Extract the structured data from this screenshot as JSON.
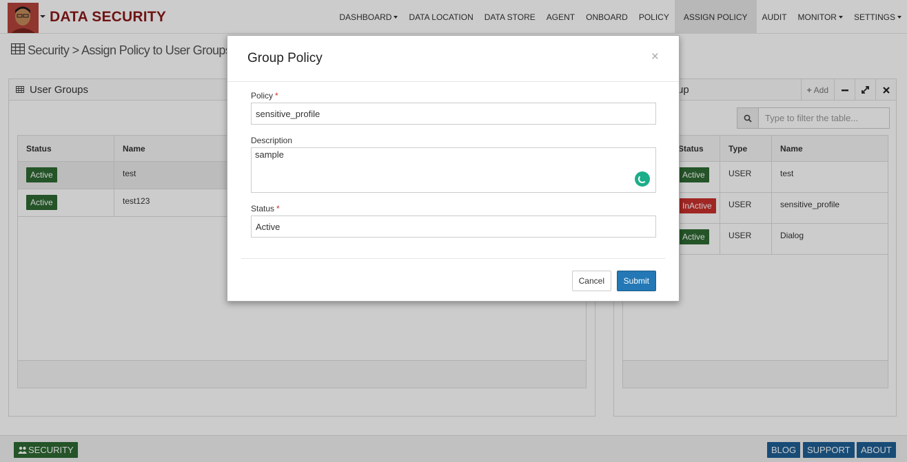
{
  "header": {
    "brand": "DATA SECURITY",
    "nav": [
      {
        "label": "DASHBOARD",
        "dropdown": true
      },
      {
        "label": "DATA LOCATION",
        "dropdown": false
      },
      {
        "label": "DATA STORE",
        "dropdown": false
      },
      {
        "label": "AGENT",
        "dropdown": false
      },
      {
        "label": "ONBOARD",
        "dropdown": false
      },
      {
        "label": "POLICY",
        "dropdown": false
      },
      {
        "label": "ASSIGN POLICY",
        "dropdown": false,
        "active": true
      },
      {
        "label": "AUDIT",
        "dropdown": false
      },
      {
        "label": "MONITOR",
        "dropdown": true
      },
      {
        "label": "SETTINGS",
        "dropdown": true
      }
    ]
  },
  "breadcrumb": "Security > Assign Policy to User Groups",
  "left_panel": {
    "title": "User Groups",
    "columns": [
      "Status",
      "Name"
    ],
    "rows": [
      {
        "status": "Active",
        "name": "test"
      },
      {
        "status": "Active",
        "name": "test123"
      }
    ]
  },
  "right_panel": {
    "title_visible": "up",
    "add_label": "Add",
    "filter_placeholder": "Type to filter the table...",
    "columns": [
      "Status",
      "Type",
      "Name"
    ],
    "rows": [
      {
        "status": "Active",
        "type": "USER",
        "name": "test"
      },
      {
        "status": "InActive",
        "type": "USER",
        "name": "sensitive_profile"
      },
      {
        "status": "Active",
        "type": "USER",
        "name": "Dialog"
      }
    ]
  },
  "modal": {
    "title": "Group Policy",
    "close": "×",
    "policy_label": "Policy",
    "policy_value": "sensitive_profile",
    "description_label": "Description",
    "description_value": "sample",
    "status_label": "Status",
    "status_value": "Active",
    "required_mark": "*",
    "cancel_label": "Cancel",
    "submit_label": "Submit"
  },
  "footer": {
    "left_button": "SECURITY",
    "right_buttons": [
      "BLOG",
      "SUPPORT",
      "ABOUT"
    ]
  },
  "colors": {
    "brand": "#8b1a1a",
    "active_badge": "#2d6a33",
    "inactive_badge": "#c9302c",
    "submit": "#2378b5",
    "footer_blue": "#1f5f95"
  }
}
